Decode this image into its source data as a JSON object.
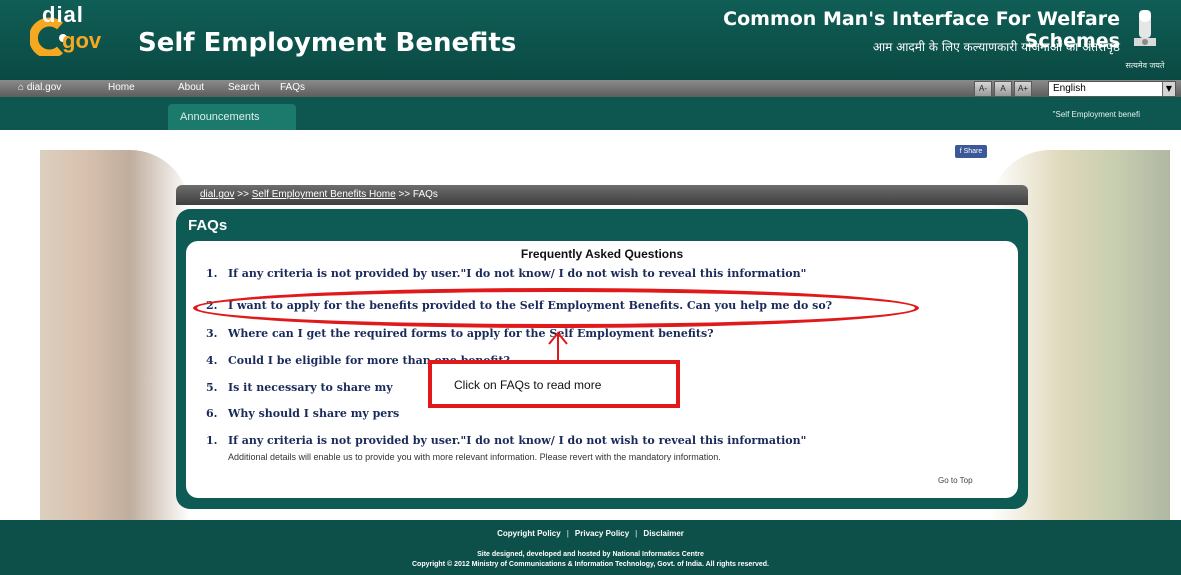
{
  "header": {
    "logo_top": "dial",
    "logo_bottom": "gov",
    "title": "Self Employment Benefits",
    "tagline": "Common Man's Interface For Welfare Schemes",
    "tagline_hindi": "आम आदमी के लिए कल्याणकारी योजनाओं का अंतरापृष्ठ",
    "emblem_caption": "सत्यमेव जयते"
  },
  "nav": {
    "items": [
      "dial.gov",
      "Home",
      "About",
      "Search",
      "FAQs"
    ],
    "font_buttons": [
      "A-",
      "A",
      "A+"
    ],
    "language": "English"
  },
  "subbar": {
    "tab": "Announcements",
    "marquee": "\"Self Employment benefi"
  },
  "share_label": "Share",
  "breadcrumb": {
    "home": "dial.gov",
    "section": "Self Employment Benefits Home",
    "current": "FAQs",
    "sep": " >> "
  },
  "faq": {
    "heading": "FAQs",
    "title": "Frequently Asked Questions",
    "questions": [
      {
        "num": "1.",
        "text": "If any criteria is not provided by user.\"I do not know/ I do not wish to reveal this information\""
      },
      {
        "num": "2.",
        "text": "I want to apply for the benefits provided to the Self Employment Benefits. Can you help me do so?"
      },
      {
        "num": "3.",
        "text": "Where can I get the required forms to apply for the Self Employment benefits?"
      },
      {
        "num": "4.",
        "text": "Could I be eligible for more than one benefit?"
      },
      {
        "num": "5.",
        "text": "Is it necessary to share my"
      },
      {
        "num": "6.",
        "text": "Why should I share my pers"
      },
      {
        "num": "1.",
        "text": "If any criteria is not provided by user.\"I do not know/ I do not wish to reveal this information\""
      }
    ],
    "note": "Additional details will enable us to provide you with more relevant information. Please revert with the mandatory information.",
    "go_top": "Go to Top"
  },
  "callout": {
    "text": "Click on FAQs to read more",
    "color": "#e01a1a"
  },
  "footer": {
    "links": [
      "Copyright Policy",
      "Privacy Policy",
      "Disclaimer"
    ],
    "line1": "Site designed, developed and hosted by National Informatics Centre",
    "line2": "Copyright © 2012 Ministry of Communications & Information Technology, Govt. of India. All rights reserved."
  }
}
